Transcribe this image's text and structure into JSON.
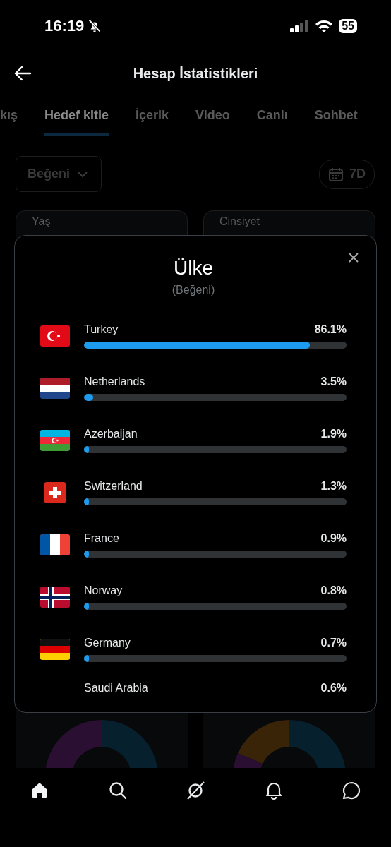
{
  "status_bar": {
    "time": "16:19",
    "battery": "55"
  },
  "header": {
    "title": "Hesap İstatistikleri"
  },
  "tabs": [
    {
      "label": "kış",
      "selected": false
    },
    {
      "label": "Hedef kitle",
      "selected": true
    },
    {
      "label": "İçerik",
      "selected": false
    },
    {
      "label": "Video",
      "selected": false
    },
    {
      "label": "Canlı",
      "selected": false
    },
    {
      "label": "Sohbet",
      "selected": false
    }
  ],
  "filters": {
    "metric": "Beğeni",
    "period": "7D"
  },
  "cards": [
    {
      "title": "Yaş"
    },
    {
      "title": "Cinsiyet"
    }
  ],
  "modal": {
    "title": "Ülke",
    "subtitle": "(Beğeni)",
    "countries": [
      {
        "kind": "turkey",
        "name": "Turkey",
        "reading": "86.1%",
        "level": 0.861
      },
      {
        "kind": "netherlands",
        "name": "Netherlands",
        "reading": "3.5%",
        "level": 0.035
      },
      {
        "kind": "azerbaijan",
        "name": "Azerbaijan",
        "reading": "1.9%",
        "level": 0.019
      },
      {
        "kind": "switzerland",
        "name": "Switzerland",
        "reading": "1.3%",
        "level": 0.013
      },
      {
        "kind": "france",
        "name": "France",
        "reading": "0.9%",
        "level": 0.009
      },
      {
        "kind": "norway",
        "name": "Norway",
        "reading": "0.8%",
        "level": 0.008
      },
      {
        "kind": "germany",
        "name": "Germany",
        "reading": "0.7%",
        "level": 0.007
      },
      {
        "name": "Saudi Arabia",
        "reading": "0.6%"
      }
    ]
  },
  "bottom_nav": [
    {
      "kind": "home",
      "selected": true
    },
    {
      "kind": "search",
      "selected": false
    },
    {
      "kind": "grok",
      "selected": false
    },
    {
      "kind": "bell",
      "selected": false
    },
    {
      "kind": "chat",
      "selected": false
    }
  ]
}
